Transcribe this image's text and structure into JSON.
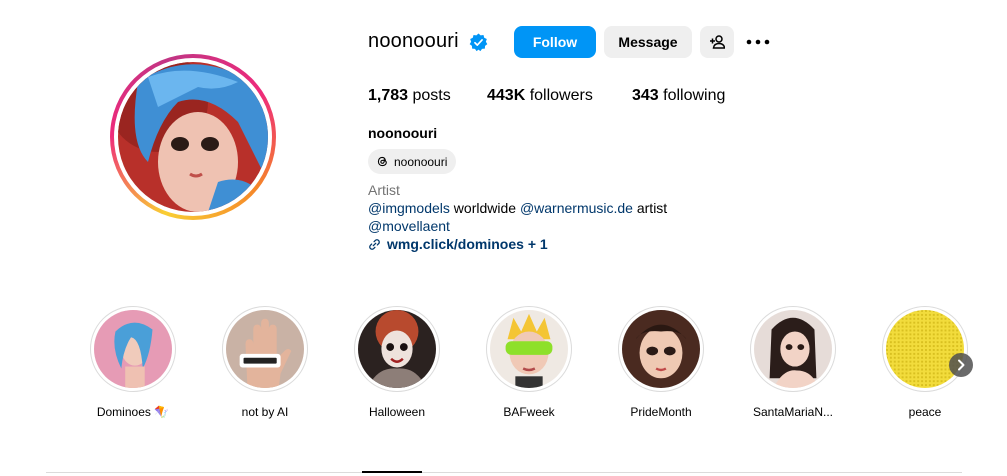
{
  "profile": {
    "username": "noonoouri",
    "full_name": "noonoouri",
    "threads_handle": "noonoouri",
    "category": "Artist",
    "bio": {
      "mention1": "@imgmodels",
      "text1": " worldwide ",
      "mention2": "@warnermusic.de",
      "text2": " artist",
      "mention3": "@movellaent"
    },
    "link": "wmg.click/dominoes + 1"
  },
  "actions": {
    "follow_label": "Follow",
    "message_label": "Message"
  },
  "stats": {
    "posts_count": "1,783",
    "posts_label": " posts",
    "followers_count": "443K",
    "followers_label": " followers",
    "following_count": "343",
    "following_label": " following"
  },
  "highlights": [
    {
      "label": "Dominoes 🪁"
    },
    {
      "label": "not by AI"
    },
    {
      "label": "Halloween"
    },
    {
      "label": "BAFweek"
    },
    {
      "label": "PrideMonth"
    },
    {
      "label": "SantaMariaN..."
    },
    {
      "label": "peace"
    }
  ],
  "colors": {
    "accent": "#0095f6",
    "link": "#00376b",
    "muted": "#737373",
    "button_bg": "#efefef"
  },
  "icons": {
    "verified": "verified-badge-icon",
    "suggest": "add-person-icon",
    "more": "more-options-icon",
    "threads": "threads-icon",
    "link": "link-icon",
    "next": "chevron-right-icon"
  }
}
